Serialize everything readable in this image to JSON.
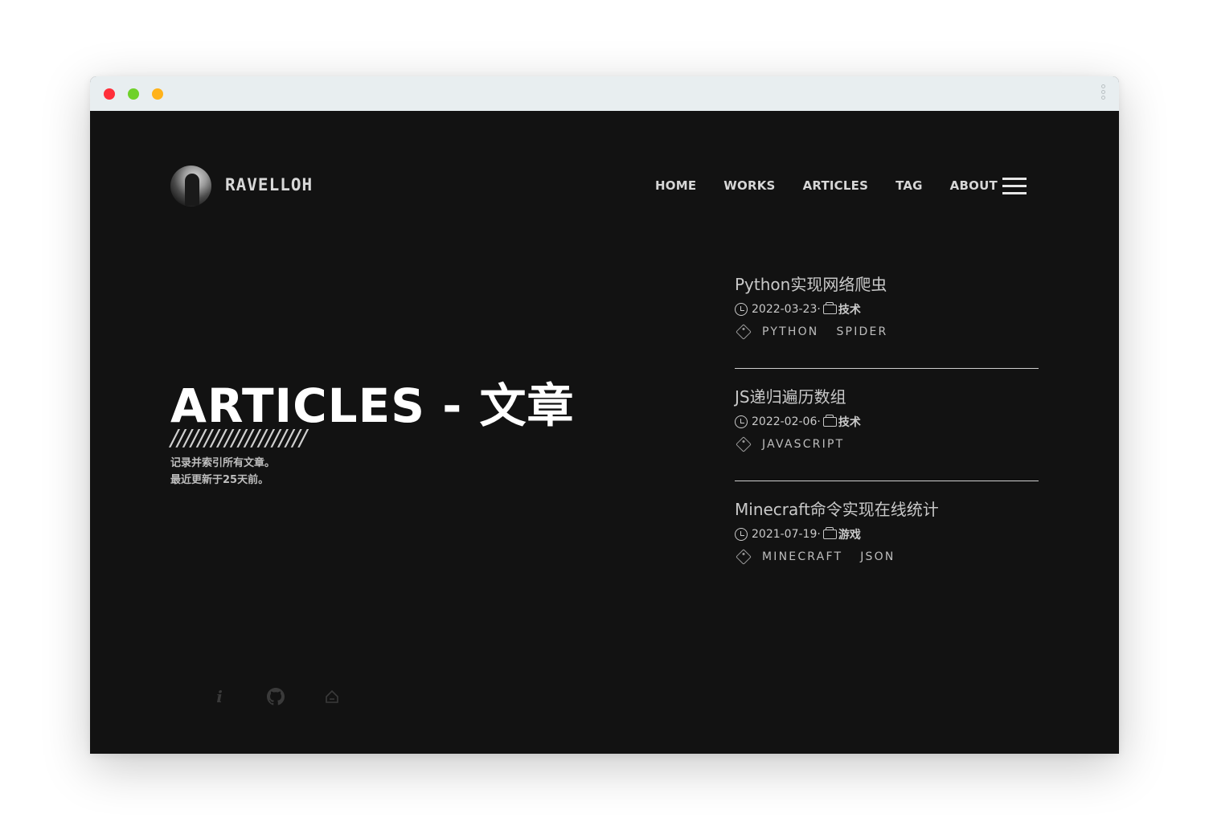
{
  "site": {
    "logo_text": "RAVELLOH"
  },
  "nav": {
    "items": [
      {
        "label": "HOME"
      },
      {
        "label": "WORKS"
      },
      {
        "label": "ARTICLES"
      },
      {
        "label": "TAG"
      },
      {
        "label": "ABOUT"
      }
    ]
  },
  "hero": {
    "title": "ARTICLES - 文章",
    "slashes": "////////////////////",
    "line1": "记录并索引所有文章。",
    "line2": "最近更新于25天前。"
  },
  "articles": [
    {
      "title": "Python实现网络爬虫",
      "date": "2022-03-23",
      "separator": " · ",
      "category": "技术",
      "tags": [
        "PYTHON",
        "SPIDER"
      ]
    },
    {
      "title": "JS递归遍历数组",
      "date": "2022-02-06",
      "separator": " · ",
      "category": "技术",
      "tags": [
        "JAVASCRIPT"
      ]
    },
    {
      "title": "Minecraft命令实现在线统计",
      "date": "2021-07-19",
      "separator": " · ",
      "category": "游戏",
      "tags": [
        "MINECRAFT",
        "JSON"
      ]
    }
  ],
  "footer": {
    "icons": [
      "info-icon",
      "github-icon",
      "home-icon"
    ]
  },
  "colors": {
    "background": "#121212",
    "titlebar": "#e8eef0",
    "close": "#ff2f3a",
    "maximize": "#6fd12a",
    "minimize": "#ffb21a"
  }
}
